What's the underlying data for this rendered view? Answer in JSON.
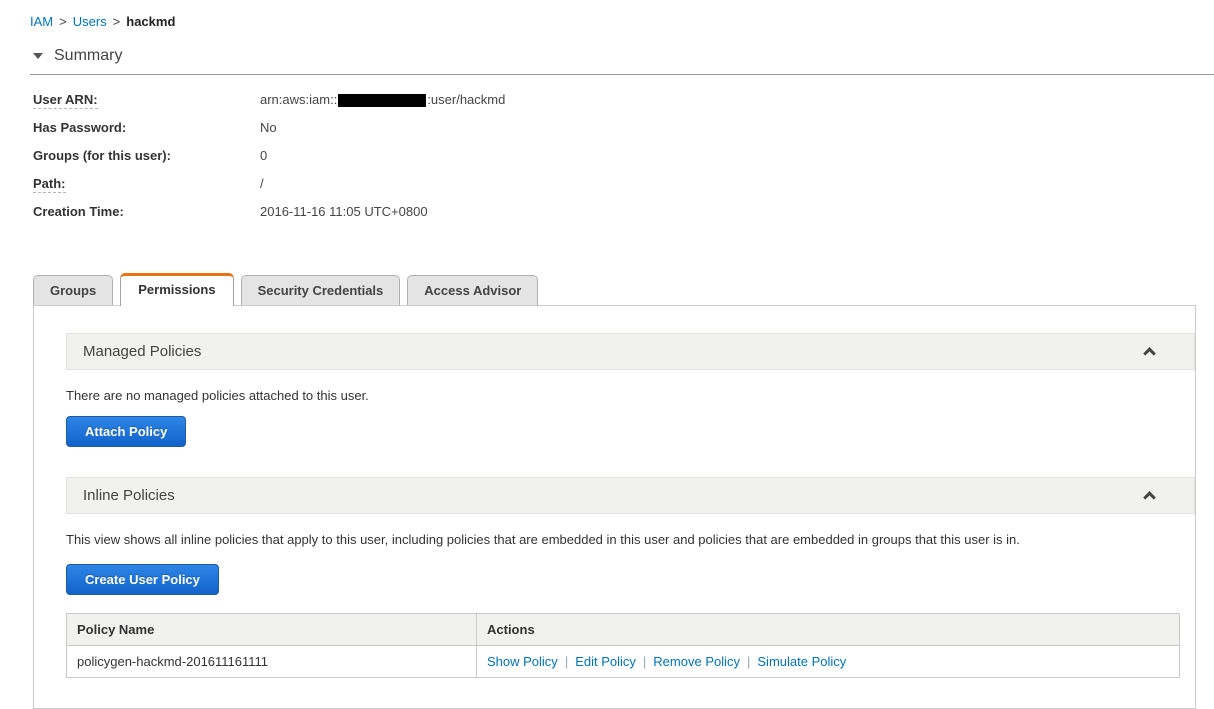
{
  "breadcrumb": {
    "separator": ">",
    "items": [
      {
        "label": "IAM"
      },
      {
        "label": "Users"
      },
      {
        "label": "hackmd"
      }
    ]
  },
  "summary": {
    "title": "Summary",
    "fields": [
      {
        "label": "User ARN:",
        "value_prefix": "arn:aws:iam::",
        "value_suffix": ":user/hackmd"
      },
      {
        "label": "Has Password:",
        "value": "No"
      },
      {
        "label": "Groups (for this user):",
        "value": "0"
      },
      {
        "label": "Path:",
        "value": "/"
      },
      {
        "label": "Creation Time:",
        "value": "2016-11-16 11:05 UTC+0800"
      }
    ]
  },
  "tabs": {
    "items": [
      {
        "label": "Groups",
        "active": false
      },
      {
        "label": "Permissions",
        "active": true
      },
      {
        "label": "Security Credentials",
        "active": false
      },
      {
        "label": "Access Advisor",
        "active": false
      }
    ]
  },
  "managed_policies": {
    "title": "Managed Policies",
    "empty_text": "There are no managed policies attached to this user.",
    "attach_button_label": "Attach Policy"
  },
  "inline_policies": {
    "title": "Inline Policies",
    "description": "This view shows all inline policies that apply to this user, including policies that are embedded in this user and policies that are embedded in groups that this user is in.",
    "create_button_label": "Create User Policy",
    "table": {
      "separator": "|",
      "columns": [
        "Policy Name",
        "Actions"
      ],
      "rows": [
        {
          "policy_name": "policygen-hackmd-201611161111",
          "actions": [
            "Show Policy",
            "Edit Policy",
            "Remove Policy",
            "Simulate Policy"
          ]
        }
      ]
    }
  },
  "colors": {
    "link": "#0073bb",
    "active_tab_accent": "#ec7211",
    "button_gradient_top": "#2f86e6",
    "button_gradient_bottom": "#1263cb",
    "section_header_bg": "#f1f1f0",
    "redaction": "#000000"
  }
}
